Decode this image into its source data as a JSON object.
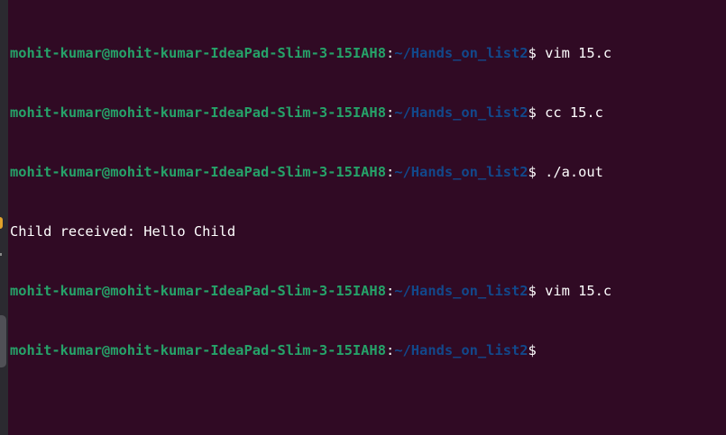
{
  "terminal": {
    "lines": [
      {
        "type": "prompt",
        "user": "mohit-kumar@mohit-kumar-IdeaPad-Slim-3-15IAH8",
        "sep": ":",
        "path": "~/Hands_on_list2",
        "symbol": "$ ",
        "command": "vim 15.c"
      },
      {
        "type": "prompt",
        "user": "mohit-kumar@mohit-kumar-IdeaPad-Slim-3-15IAH8",
        "sep": ":",
        "path": "~/Hands_on_list2",
        "symbol": "$ ",
        "command": "cc 15.c"
      },
      {
        "type": "prompt",
        "user": "mohit-kumar@mohit-kumar-IdeaPad-Slim-3-15IAH8",
        "sep": ":",
        "path": "~/Hands_on_list2",
        "symbol": "$ ",
        "command": "./a.out"
      },
      {
        "type": "output",
        "text": "Child received: Hello Child"
      },
      {
        "type": "prompt",
        "user": "mohit-kumar@mohit-kumar-IdeaPad-Slim-3-15IAH8",
        "sep": ":",
        "path": "~/Hands_on_list2",
        "symbol": "$ ",
        "command": "vim 15.c"
      },
      {
        "type": "prompt",
        "user": "mohit-kumar@mohit-kumar-IdeaPad-Slim-3-15IAH8",
        "sep": ":",
        "path": "~/Hands_on_list2",
        "symbol": "$",
        "command": ""
      }
    ]
  },
  "colors": {
    "background": "#300a24",
    "user": "#26a269",
    "path": "#12488b",
    "text": "#ffffff"
  }
}
